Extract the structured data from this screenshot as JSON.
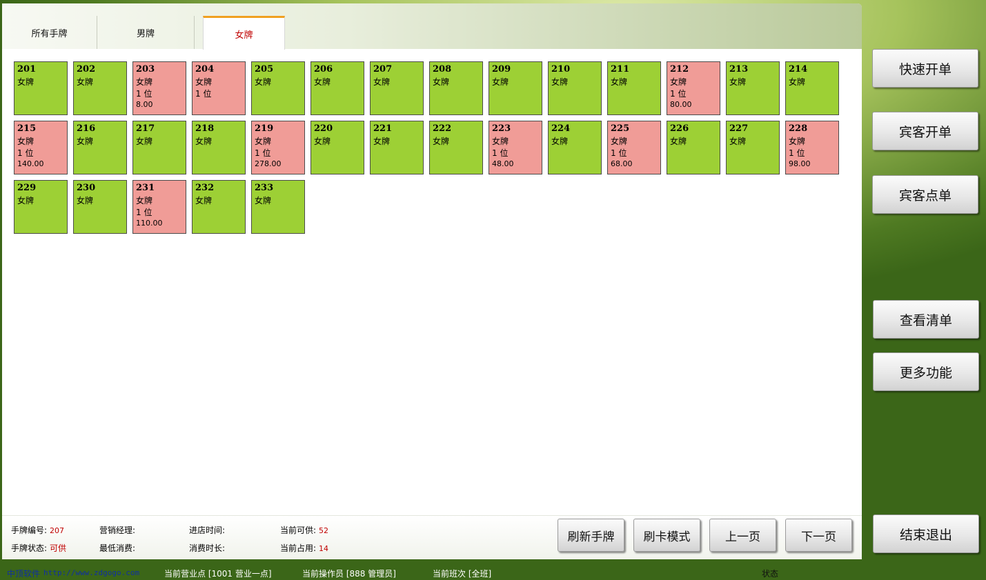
{
  "tabs": [
    {
      "label": "所有手牌",
      "active": false
    },
    {
      "label": "男牌",
      "active": false
    },
    {
      "label": "女牌",
      "active": true
    }
  ],
  "tiles": [
    {
      "num": "201",
      "kind": "女牌",
      "status": "free"
    },
    {
      "num": "202",
      "kind": "女牌",
      "status": "free"
    },
    {
      "num": "203",
      "kind": "女牌",
      "status": "busy",
      "guests": "1 位",
      "amount": "8.00"
    },
    {
      "num": "204",
      "kind": "女牌",
      "status": "busy",
      "guests": "1 位"
    },
    {
      "num": "205",
      "kind": "女牌",
      "status": "free"
    },
    {
      "num": "206",
      "kind": "女牌",
      "status": "free"
    },
    {
      "num": "207",
      "kind": "女牌",
      "status": "free"
    },
    {
      "num": "208",
      "kind": "女牌",
      "status": "free"
    },
    {
      "num": "209",
      "kind": "女牌",
      "status": "free"
    },
    {
      "num": "210",
      "kind": "女牌",
      "status": "free"
    },
    {
      "num": "211",
      "kind": "女牌",
      "status": "free"
    },
    {
      "num": "212",
      "kind": "女牌",
      "status": "busy",
      "guests": "1 位",
      "amount": "80.00"
    },
    {
      "num": "213",
      "kind": "女牌",
      "status": "free"
    },
    {
      "num": "214",
      "kind": "女牌",
      "status": "free"
    },
    {
      "num": "215",
      "kind": "女牌",
      "status": "busy",
      "guests": "1 位",
      "amount": "140.00"
    },
    {
      "num": "216",
      "kind": "女牌",
      "status": "free"
    },
    {
      "num": "217",
      "kind": "女牌",
      "status": "free"
    },
    {
      "num": "218",
      "kind": "女牌",
      "status": "free"
    },
    {
      "num": "219",
      "kind": "女牌",
      "status": "busy",
      "guests": "1 位",
      "amount": "278.00"
    },
    {
      "num": "220",
      "kind": "女牌",
      "status": "free"
    },
    {
      "num": "221",
      "kind": "女牌",
      "status": "free"
    },
    {
      "num": "222",
      "kind": "女牌",
      "status": "free"
    },
    {
      "num": "223",
      "kind": "女牌",
      "status": "busy",
      "guests": "1 位",
      "amount": "48.00"
    },
    {
      "num": "224",
      "kind": "女牌",
      "status": "free"
    },
    {
      "num": "225",
      "kind": "女牌",
      "status": "busy",
      "guests": "1 位",
      "amount": "68.00"
    },
    {
      "num": "226",
      "kind": "女牌",
      "status": "free"
    },
    {
      "num": "227",
      "kind": "女牌",
      "status": "free"
    },
    {
      "num": "228",
      "kind": "女牌",
      "status": "busy",
      "guests": "1 位",
      "amount": "98.00"
    },
    {
      "num": "229",
      "kind": "女牌",
      "status": "free"
    },
    {
      "num": "230",
      "kind": "女牌",
      "status": "free"
    },
    {
      "num": "231",
      "kind": "女牌",
      "status": "busy",
      "guests": "1 位",
      "amount": "110.00"
    },
    {
      "num": "232",
      "kind": "女牌",
      "status": "free"
    },
    {
      "num": "233",
      "kind": "女牌",
      "status": "free"
    }
  ],
  "info": {
    "tag_no_label": "手牌编号:",
    "tag_no_value": "207",
    "tag_status_label": "手牌状态:",
    "tag_status_value": "可供",
    "manager_label": "营销经理:",
    "manager_value": "",
    "min_spend_label": "最低消费:",
    "min_spend_value": "",
    "checkin_label": "进店时间:",
    "checkin_value": "",
    "duration_label": "消费时长:",
    "duration_value": "",
    "available_label": "当前可供:",
    "available_value": "52",
    "occupied_label": "当前占用:",
    "occupied_value": "14"
  },
  "actions": {
    "refresh": "刷新手牌",
    "card_mode": "刷卡模式",
    "prev_page": "上一页",
    "next_page": "下一页"
  },
  "sidebar": {
    "quick_open": "快速开单",
    "guest_open": "宾客开单",
    "guest_order": "宾客点单",
    "view_list": "查看清单",
    "more": "更多功能",
    "exit": "结束退出"
  },
  "status_bar": {
    "brand": "中顶软件",
    "url": "http://www.zdgogo.com",
    "business_point": "当前营业点 [1001 营业一点]",
    "operator": "当前操作员 [888 管理员]",
    "shift": "当前班次 [全班]",
    "status": "状态"
  },
  "colors": {
    "tile_free": "#9dd035",
    "tile_busy": "#f09c97",
    "value_red": "#c00000",
    "active_tab": "#c00000"
  }
}
